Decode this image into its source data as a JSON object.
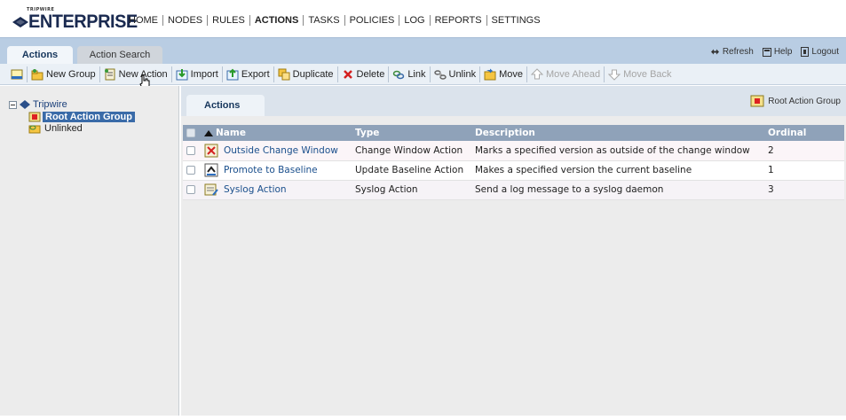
{
  "brand": {
    "small": "TRIPWIRE",
    "name": "ENTERPRISE"
  },
  "nav": [
    {
      "label": "HOME",
      "active": false
    },
    {
      "label": "NODES",
      "active": false
    },
    {
      "label": "RULES",
      "active": false
    },
    {
      "label": "ACTIONS",
      "active": true
    },
    {
      "label": "TASKS",
      "active": false
    },
    {
      "label": "POLICIES",
      "active": false
    },
    {
      "label": "LOG",
      "active": false
    },
    {
      "label": "REPORTS",
      "active": false
    },
    {
      "label": "SETTINGS",
      "active": false
    }
  ],
  "tabs": {
    "actions": "Actions",
    "action_search": "Action Search"
  },
  "topright": {
    "refresh": "Refresh",
    "help": "Help",
    "logout": "Logout"
  },
  "toolbar": {
    "new_group": "New Group",
    "new_action": "New Action",
    "import": "Import",
    "export": "Export",
    "duplicate": "Duplicate",
    "delete": "Delete",
    "link": "Link",
    "unlink": "Unlink",
    "move": "Move",
    "move_ahead": "Move Ahead",
    "move_back": "Move Back"
  },
  "tree": {
    "root": "Tripwire",
    "items": [
      {
        "label": "Root Action Group",
        "selected": true
      },
      {
        "label": "Unlinked",
        "selected": false
      }
    ]
  },
  "content": {
    "tab": "Actions",
    "group_label": "Root Action Group"
  },
  "table": {
    "headers": {
      "name": "Name",
      "type": "Type",
      "description": "Description",
      "ordinal": "Ordinal"
    },
    "rows": [
      {
        "name": "Outside Change Window",
        "type": "Change Window Action",
        "description": "Marks a specified version as outside of the change window",
        "ordinal": "2",
        "icon": "change-window-icon"
      },
      {
        "name": "Promote to Baseline",
        "type": "Update Baseline Action",
        "description": "Makes a specified version the current baseline",
        "ordinal": "1",
        "icon": "baseline-icon"
      },
      {
        "name": "Syslog Action",
        "type": "Syslog Action",
        "description": "Send a log message to a syslog daemon",
        "ordinal": "3",
        "icon": "syslog-icon"
      }
    ]
  }
}
